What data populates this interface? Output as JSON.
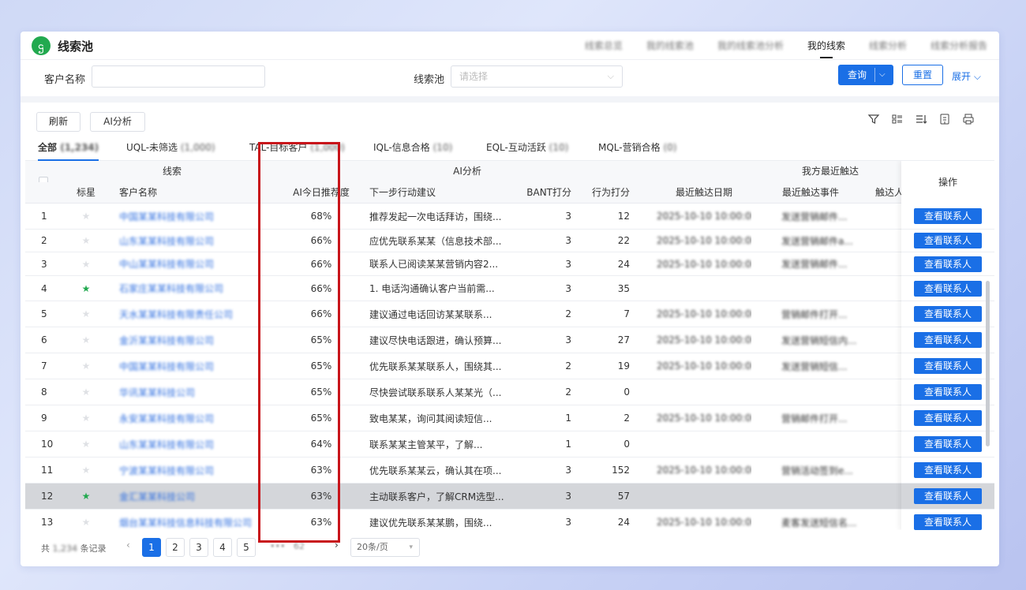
{
  "header": {
    "logo_glyph": "ဌ",
    "title": "线索池",
    "tabs": [
      {
        "label": "线索总览",
        "blurred": true
      },
      {
        "label": "我的线索池",
        "blurred": true
      },
      {
        "label": "我的线索池分析",
        "blurred": true
      },
      {
        "label": "我的线索",
        "blurred": false,
        "active": true
      },
      {
        "label": "线索分析",
        "blurred": true
      },
      {
        "label": "线索分析报告",
        "blurred": true
      }
    ]
  },
  "filters": {
    "customer_label": "客户名称",
    "pool_label": "线索池",
    "pool_placeholder": "请选择",
    "query": "查询",
    "reset": "重置",
    "expand": "展开"
  },
  "toolbar": {
    "refresh": "刷新",
    "ai_analysis": "AI分析"
  },
  "status_tabs": [
    {
      "label": "全部",
      "count": "(1,234)",
      "active": true
    },
    {
      "label": "UQL-未筛选",
      "count": "(1,000)"
    },
    {
      "label": "TAL-目标客户",
      "count": "(1,000)"
    },
    {
      "label": "IQL-信息合格",
      "count": "(10)"
    },
    {
      "label": "EQL-互动活跃",
      "count": "(10)"
    },
    {
      "label": "MQL-营销合格",
      "count": "(0)"
    }
  ],
  "table": {
    "group_headers": {
      "lead": "线索",
      "ai": "AI分析",
      "recent": "我方最近触达",
      "op": "操作"
    },
    "columns": {
      "star": "标星",
      "name": "客户名称",
      "pct": "AI今日推荐度",
      "next": "下一步行动建议",
      "bant": "BANT打分",
      "behavior": "行为打分",
      "date": "最近触达日期",
      "event": "最近触达事件",
      "person": "触达人"
    },
    "op_label": "查看联系人",
    "rows": [
      {
        "idx": "1",
        "star": false,
        "name": "中国某某科技有限公司",
        "pct": "68%",
        "next": "推荐发起一次电话拜访，围绕...",
        "bant": "3",
        "behavior": "12",
        "date": "2025-10-10 10:00:00",
        "event": "发送营销邮件..."
      },
      {
        "idx": "2",
        "star": false,
        "name": "山东某某科技有限公司",
        "pct": "66%",
        "next": "应优先联系某某（信息技术部...",
        "bant": "3",
        "behavior": "22",
        "date": "2025-10-10 10:00:00",
        "event": "发送营销邮件a..."
      },
      {
        "idx": "3",
        "star": false,
        "name": "中山某某科技有限公司",
        "pct": "66%",
        "next": "联系人已阅读某某营销内容2...",
        "bant": "3",
        "behavior": "24",
        "date": "2025-10-10 10:00:00",
        "event": "发送营销邮件..."
      },
      {
        "idx": "4",
        "star": true,
        "name": "石家庄某某科技有限公司",
        "pct": "66%",
        "next": "1. 电话沟通确认客户当前需...",
        "bant": "3",
        "behavior": "35",
        "date": "",
        "event": ""
      },
      {
        "idx": "5",
        "star": false,
        "name": "天水某某科技有限责任公司",
        "pct": "66%",
        "next": "建议通过电话回访某某联系...",
        "bant": "2",
        "behavior": "7",
        "date": "2025-10-10 10:00:00",
        "event": "营销邮件打开..."
      },
      {
        "idx": "6",
        "star": false,
        "name": "金沂某某科技有限公司",
        "pct": "65%",
        "next": "建议尽快电话跟进，确认预算...",
        "bant": "3",
        "behavior": "27",
        "date": "2025-10-10 10:00:00",
        "event": "发送营销短信内..."
      },
      {
        "idx": "7",
        "star": false,
        "name": "中国某某科技有限公司",
        "pct": "65%",
        "next": "优先联系某某联系人，围绕其...",
        "bant": "2",
        "behavior": "19",
        "date": "2025-10-10 10:00:00",
        "event": "发送营销短信..."
      },
      {
        "idx": "8",
        "star": false,
        "name": "华讯某某科技公司",
        "pct": "65%",
        "next": "尽快尝试联系联系人某某光（...",
        "bant": "2",
        "behavior": "0",
        "date": "",
        "event": ""
      },
      {
        "idx": "9",
        "star": false,
        "name": "永安某某科技有限公司",
        "pct": "65%",
        "next": "致电某某，询问其阅读短信...",
        "bant": "1",
        "behavior": "2",
        "date": "2025-10-10 10:00:00",
        "event": "营销邮件打开..."
      },
      {
        "idx": "10",
        "star": false,
        "name": "山东某某科技有限公司",
        "pct": "64%",
        "next": "联系某某主管某平，了解...",
        "bant": "1",
        "behavior": "0",
        "date": "",
        "event": ""
      },
      {
        "idx": "11",
        "star": false,
        "name": "宁波某某科技有限公司",
        "pct": "63%",
        "next": "优先联系某某云，确认其在项...",
        "bant": "3",
        "behavior": "152",
        "date": "2025-10-10 10:00:00",
        "event": "营销活动签到e..."
      },
      {
        "idx": "12",
        "star": true,
        "name": "金汇某某科技公司",
        "pct": "63%",
        "next": "主动联系客户，了解CRM选型...",
        "bant": "3",
        "behavior": "57",
        "date": "",
        "event": "",
        "selected": true
      },
      {
        "idx": "13",
        "star": false,
        "name": "烟台某某科技信息科技有限公司",
        "pct": "63%",
        "next": "建议优先联系某某鹏，围绕...",
        "bant": "3",
        "behavior": "24",
        "date": "2025-10-10 10:00:00",
        "event": "麦客发送短信名..."
      }
    ]
  },
  "pager": {
    "total_prefix": "共",
    "total_count": "1,234",
    "total_suffix": "条记录",
    "pages": [
      "1",
      "2",
      "3",
      "4",
      "5"
    ],
    "ellipsis": "•••",
    "last_page": "62",
    "page_size": "20条/页"
  },
  "colors": {
    "accent": "#1a6fe6",
    "highlight": "#c8141a",
    "star_active": "#22a94f"
  }
}
